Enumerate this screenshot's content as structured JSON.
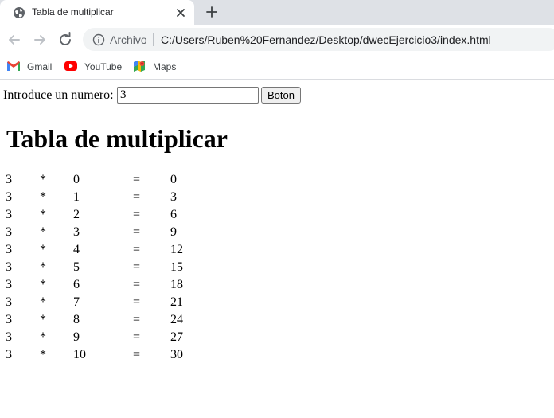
{
  "browser": {
    "tab": {
      "title": "Tabla de multiplicar"
    },
    "address": {
      "scheme_label": "Archivo",
      "url": "C:/Users/Ruben%20Fernandez/Desktop/dwecEjercicio3/index.html"
    },
    "bookmarks": [
      {
        "label": "Gmail",
        "icon": "gmail-icon"
      },
      {
        "label": "YouTube",
        "icon": "youtube-icon"
      },
      {
        "label": "Maps",
        "icon": "maps-icon"
      }
    ]
  },
  "page": {
    "form": {
      "label": "Introduce un numero:",
      "input_value": "3",
      "button_label": "Boton"
    },
    "heading": "Tabla de multiplicar",
    "rows": [
      {
        "a": "3",
        "op": "*",
        "b": "0",
        "eq": "=",
        "result": "0"
      },
      {
        "a": "3",
        "op": "*",
        "b": "1",
        "eq": "=",
        "result": "3"
      },
      {
        "a": "3",
        "op": "*",
        "b": "2",
        "eq": "=",
        "result": "6"
      },
      {
        "a": "3",
        "op": "*",
        "b": "3",
        "eq": "=",
        "result": "9"
      },
      {
        "a": "3",
        "op": "*",
        "b": "4",
        "eq": "=",
        "result": "12"
      },
      {
        "a": "3",
        "op": "*",
        "b": "5",
        "eq": "=",
        "result": "15"
      },
      {
        "a": "3",
        "op": "*",
        "b": "6",
        "eq": "=",
        "result": "18"
      },
      {
        "a": "3",
        "op": "*",
        "b": "7",
        "eq": "=",
        "result": "21"
      },
      {
        "a": "3",
        "op": "*",
        "b": "8",
        "eq": "=",
        "result": "24"
      },
      {
        "a": "3",
        "op": "*",
        "b": "9",
        "eq": "=",
        "result": "27"
      },
      {
        "a": "3",
        "op": "*",
        "b": "10",
        "eq": "=",
        "result": "30"
      }
    ]
  }
}
